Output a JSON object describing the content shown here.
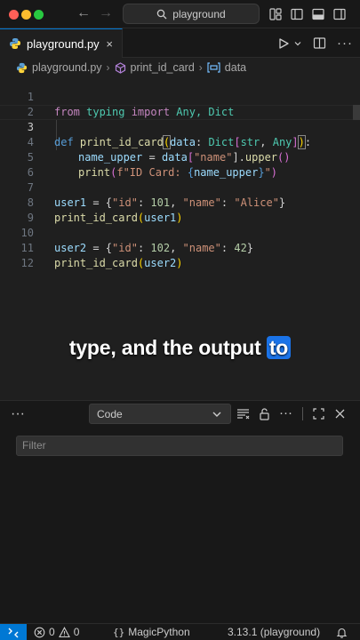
{
  "titlebar": {
    "search_text": "playground"
  },
  "tab": {
    "filename": "playground.py",
    "close_glyph": "×"
  },
  "breadcrumb": {
    "file": "playground.py",
    "function": "print_id_card",
    "variable": "data"
  },
  "editor": {
    "line_numbers": [
      "1",
      "2",
      "3",
      "4",
      "5",
      "6",
      "7",
      "8",
      "9",
      "10",
      "11",
      "12"
    ],
    "active_line": "3",
    "lines": {
      "l1": [
        "from",
        " typing ",
        "import",
        " Any, Dict"
      ],
      "l3": [
        "def",
        " ",
        "print_id_card",
        "(",
        "data",
        ": ",
        "Dict",
        "[",
        "str",
        ", ",
        "Any",
        "]",
        ")",
        ":"
      ],
      "l4": [
        "name_upper",
        " = ",
        "data",
        "[",
        "\"name\"",
        "].",
        "upper",
        "()"
      ],
      "l5": [
        "print",
        "(",
        "f\"ID Card: ",
        "{",
        "name_upper",
        "}",
        "\"",
        ")"
      ],
      "l7": [
        "user1",
        " = {",
        "\"id\"",
        ": ",
        "101",
        ", ",
        "\"name\"",
        ": ",
        "\"Alice\"",
        "}"
      ],
      "l8": [
        "print_id_card",
        "(",
        "user1",
        ")"
      ],
      "l10": [
        "user2",
        " = {",
        "\"id\"",
        ": ",
        "102",
        ", ",
        "\"name\"",
        ": ",
        "42",
        "}"
      ],
      "l11": [
        "print_id_card",
        "(",
        "user2",
        ")"
      ]
    }
  },
  "caption": {
    "text": "type, and the output ",
    "highlight": "to"
  },
  "panel": {
    "select_value": "Code",
    "filter_placeholder": "Filter"
  },
  "statusbar": {
    "errors": "0",
    "warnings": "0",
    "language": "MagicPython",
    "interpreter": "3.13.1 (playground)"
  },
  "colors": {
    "accent": "#0078d4",
    "caption_highlight": "#1a73e8",
    "keyword": "#c586c0",
    "function": "#dcdcaa",
    "string": "#ce9178"
  }
}
